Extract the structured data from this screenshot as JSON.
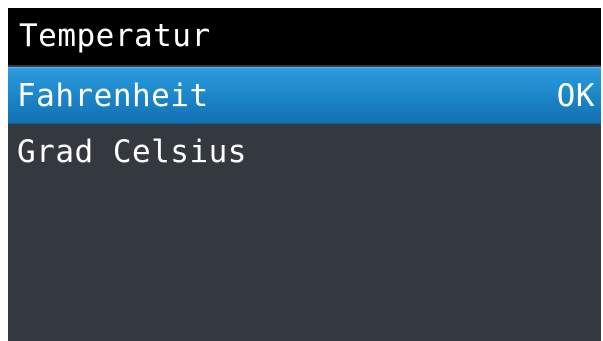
{
  "screen": {
    "title": "Temperatur",
    "items": [
      {
        "label": "Fahrenheit",
        "selected": true,
        "confirm_label": "OK"
      },
      {
        "label": "Grad Celsius",
        "selected": false
      }
    ]
  },
  "colors": {
    "title_background": "#000000",
    "screen_background": "#34383f",
    "selection_highlight": "#1c86c8",
    "text": "#ffffff"
  }
}
